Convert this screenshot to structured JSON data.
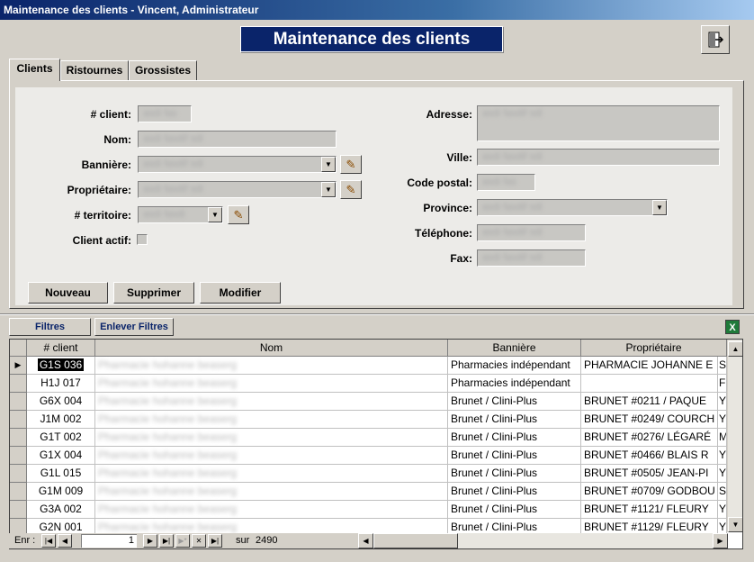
{
  "window": {
    "title": "Maintenance des clients - Vincent, Administrateur"
  },
  "banner": {
    "title": "Maintenance des clients"
  },
  "tabs": [
    {
      "label": "Clients",
      "active": true
    },
    {
      "label": "Ristournes",
      "active": false
    },
    {
      "label": "Grossistes",
      "active": false
    }
  ],
  "form": {
    "client_no": {
      "label": "# client:",
      "value": "asdi fas"
    },
    "nom": {
      "label": "Nom:",
      "value": "asdi fasdif sdi"
    },
    "banniere": {
      "label": "Bannière:",
      "value": "asdi fasdif sdi"
    },
    "proprietaire": {
      "label": "Propriétaire:",
      "value": "asdi fasdif sdi"
    },
    "territoire": {
      "label": "# territoire:",
      "value": "asdi fasdi"
    },
    "client_actif": {
      "label": "Client actif:",
      "checked": false
    },
    "adresse": {
      "label": "Adresse:",
      "value": "asdi fasdif sdi"
    },
    "ville": {
      "label": "Ville:",
      "value": "asdi fasdif sdi"
    },
    "code_postal": {
      "label": "Code postal:",
      "value": "asdi fas"
    },
    "province": {
      "label": "Province:",
      "value": "asdi fasdif sdi"
    },
    "telephone": {
      "label": "Téléphone:",
      "value": "asdi fasdif sdi"
    },
    "fax": {
      "label": "Fax:",
      "value": "asdi fasdif sdi"
    }
  },
  "buttons": {
    "nouveau": "Nouveau",
    "supprimer": "Supprimer",
    "modifier": "Modifier"
  },
  "filters": {
    "filtres": "Filtres",
    "enlever": "Enlever Filtres"
  },
  "grid": {
    "columns": [
      "# client",
      "Nom",
      "Bannière",
      "Propriétaire"
    ],
    "rows": [
      {
        "id": "G1S 036",
        "nom": "Pharmacie hohanne beaserg",
        "banniere": "Pharmacies indépendant",
        "proprietaire": "PHARMACIE JOHANNE E",
        "extra": "S",
        "current": true
      },
      {
        "id": "H1J 017",
        "nom": "Pharmacie hohanne beaserg",
        "banniere": "Pharmacies indépendant",
        "proprietaire": "",
        "extra": "F"
      },
      {
        "id": "G6X 004",
        "nom": "Pharmacie hohanne beaserg",
        "banniere": "Brunet / Clini-Plus",
        "proprietaire": "BRUNET #0211 / PAQUE",
        "extra": "Y"
      },
      {
        "id": "J1M 002",
        "nom": "Pharmacie hohanne beaserg",
        "banniere": "Brunet / Clini-Plus",
        "proprietaire": "BRUNET #0249/ COURCH",
        "extra": "Y"
      },
      {
        "id": "G1T 002",
        "nom": "Pharmacie hohanne beaserg",
        "banniere": "Brunet / Clini-Plus",
        "proprietaire": "BRUNET #0276/ LÉGARÉ",
        "extra": "M"
      },
      {
        "id": "G1X 004",
        "nom": "Pharmacie hohanne beaserg",
        "banniere": "Brunet / Clini-Plus",
        "proprietaire": "BRUNET #0466/ BLAIS R",
        "extra": "Y"
      },
      {
        "id": "G1L 015",
        "nom": "Pharmacie hohanne beaserg",
        "banniere": "Brunet / Clini-Plus",
        "proprietaire": "BRUNET #0505/ JEAN-PI",
        "extra": "Y"
      },
      {
        "id": "G1M 009",
        "nom": "Pharmacie hohanne beaserg",
        "banniere": "Brunet / Clini-Plus",
        "proprietaire": "BRUNET #0709/ GODBOU",
        "extra": "S"
      },
      {
        "id": "G3A 002",
        "nom": "Pharmacie hohanne beaserg",
        "banniere": "Brunet / Clini-Plus",
        "proprietaire": "BRUNET #1121/ FLEURY",
        "extra": "Y"
      },
      {
        "id": "G2N 001",
        "nom": "Pharmacie hohanne beaserg",
        "banniere": "Brunet / Clini-Plus",
        "proprietaire": "BRUNET #1129/ FLEURY",
        "extra": "Y"
      }
    ]
  },
  "navigator": {
    "label": "Enr :",
    "current": "1",
    "sur": "sur",
    "total": "2490"
  },
  "colors": {
    "banner": "#0a246a",
    "chrome": "#d4d0c8",
    "form_bg": "#ecebe8"
  }
}
